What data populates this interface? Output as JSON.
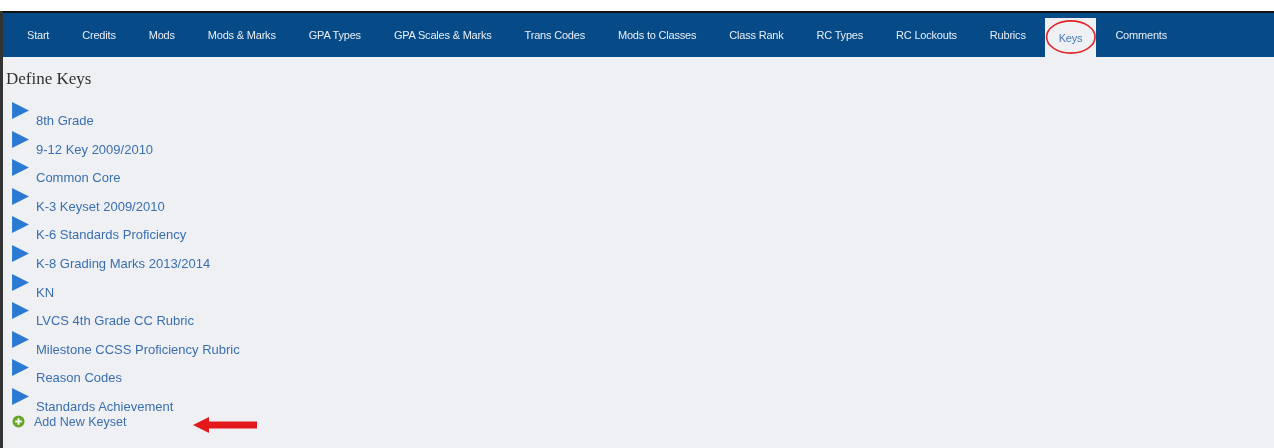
{
  "tabs": [
    {
      "label": "Start",
      "selected": false,
      "circled": false
    },
    {
      "label": "Credits",
      "selected": false,
      "circled": false
    },
    {
      "label": "Mods",
      "selected": false,
      "circled": false
    },
    {
      "label": "Mods & Marks",
      "selected": false,
      "circled": false
    },
    {
      "label": "GPA Types",
      "selected": false,
      "circled": false
    },
    {
      "label": "GPA Scales & Marks",
      "selected": false,
      "circled": false
    },
    {
      "label": "Trans Codes",
      "selected": false,
      "circled": false
    },
    {
      "label": "Mods to Classes",
      "selected": false,
      "circled": false
    },
    {
      "label": "Class Rank",
      "selected": false,
      "circled": false
    },
    {
      "label": "RC Types",
      "selected": false,
      "circled": false
    },
    {
      "label": "RC Lockouts",
      "selected": false,
      "circled": false
    },
    {
      "label": "Rubrics",
      "selected": false,
      "circled": false
    },
    {
      "label": "Keys",
      "selected": true,
      "circled": true
    },
    {
      "label": "Comments",
      "selected": false,
      "circled": false
    }
  ],
  "page_title": "Define Keys",
  "keysets": [
    "8th Grade",
    "9-12 Key 2009/2010",
    "Common Core",
    "K-3 Keyset 2009/2010",
    "K-6 Standards Proficiency",
    "K-8 Grading Marks 2013/2014",
    "KN",
    "LVCS 4th Grade CC Rubric",
    "Milestone CCSS Proficiency Rubric",
    "Reason Codes",
    "Standards Achievement"
  ],
  "add_link": {
    "label": "Add New Keyset",
    "arrow": true
  }
}
